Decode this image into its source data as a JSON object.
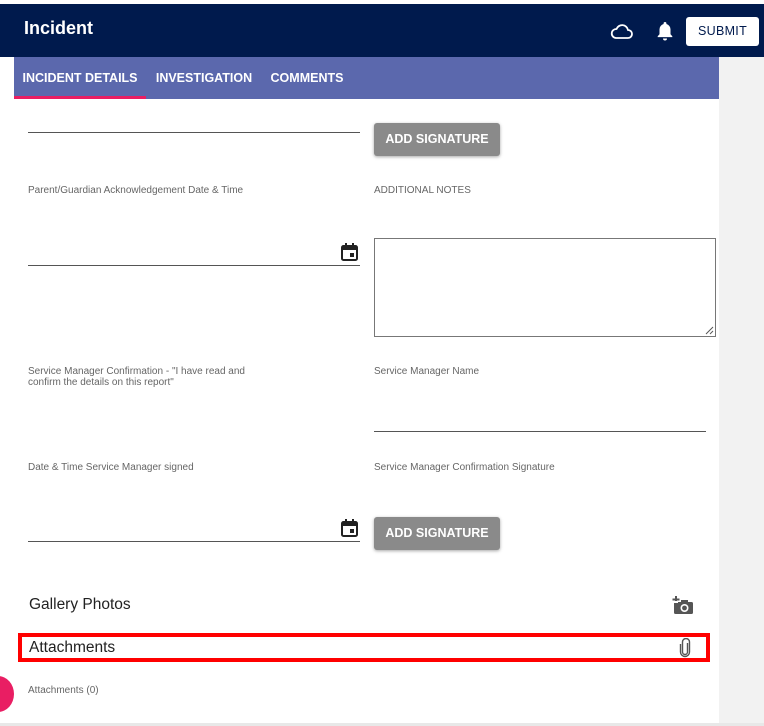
{
  "header": {
    "title": "Incident",
    "submit_label": "SUBMIT",
    "icons": [
      "cloud-icon",
      "bell-icon"
    ]
  },
  "tabs": [
    {
      "label": "INCIDENT DETAILS",
      "active": true
    },
    {
      "label": "INVESTIGATION",
      "active": false
    },
    {
      "label": "COMMENTS",
      "active": false
    }
  ],
  "form": {
    "add_signature_label": "ADD SIGNATURE",
    "parent_ack_label": "Parent/Guardian Acknowledgement Date & Time",
    "additional_notes_label": "ADDITIONAL NOTES",
    "manager_confirmation_line1": "Service Manager Confirmation - \"I have read and",
    "manager_confirmation_line2": "confirm the details on this report\"",
    "manager_name_label": "Service Manager Name",
    "manager_signed_label": "Date & Time Service Manager signed",
    "manager_signature_label": "Service Manager Confirmation Signature"
  },
  "gallery": {
    "title": "Gallery Photos"
  },
  "attachments": {
    "title": "Attachments",
    "count_label": "Attachments (0)"
  },
  "colors": {
    "header_bg": "#001a4d",
    "tabs_bg": "#5b68ad",
    "tab_indicator": "#e91e63",
    "signature_button": "#8a8a8a",
    "highlight_box": "#ff0000"
  }
}
